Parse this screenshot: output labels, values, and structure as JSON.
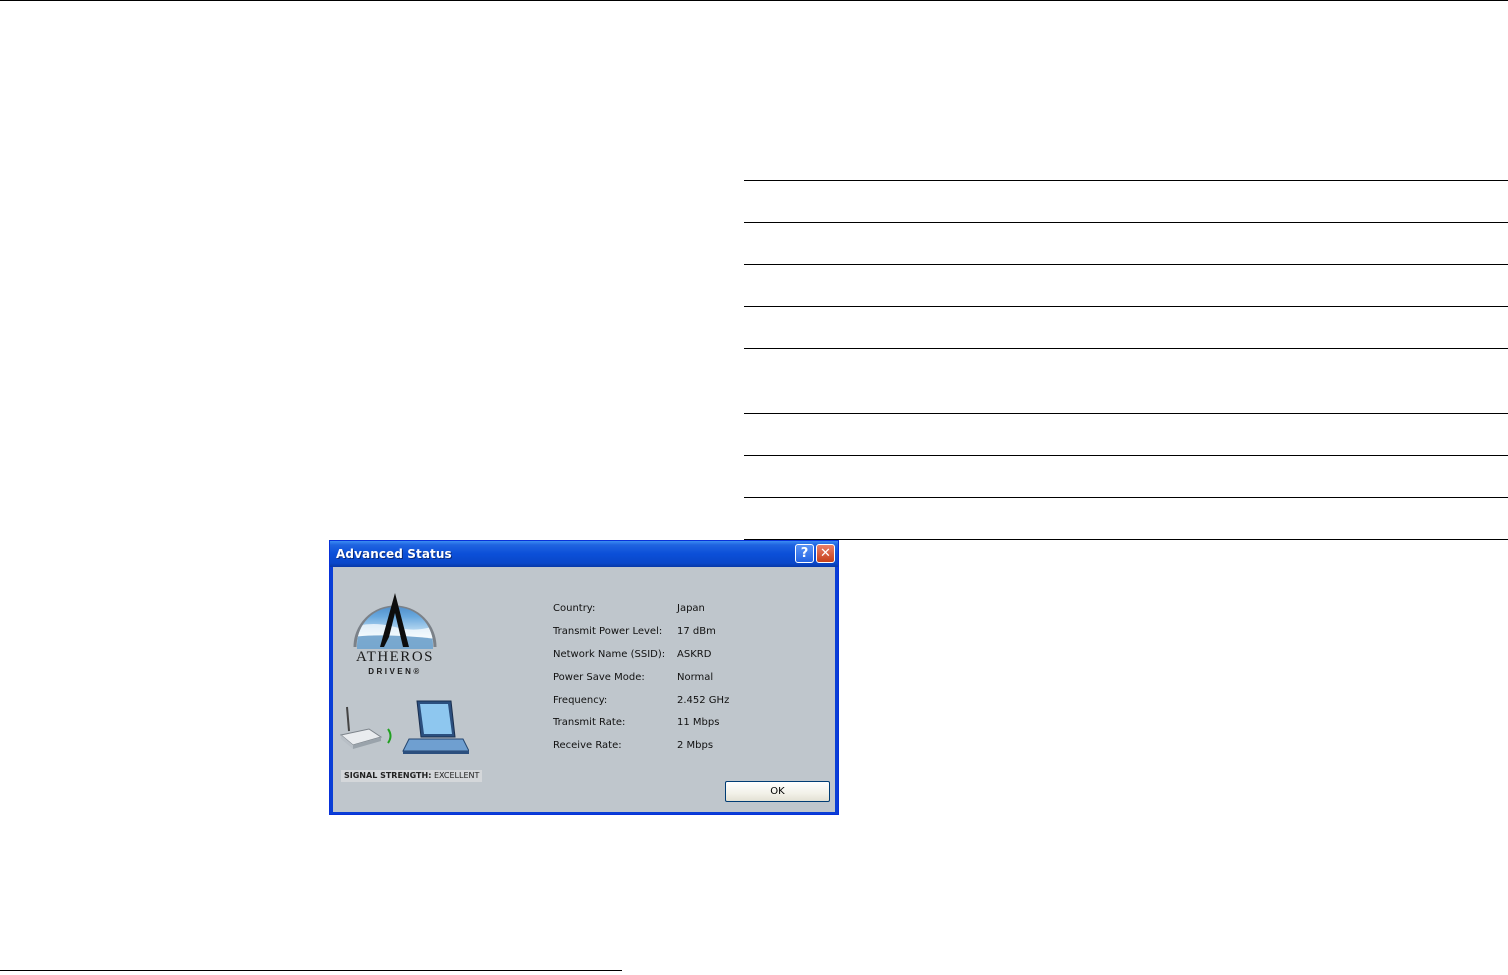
{
  "dialog": {
    "title": "Advanced Status",
    "help_glyph": "?",
    "close_glyph": "✕",
    "logo": {
      "wordmark": "ATHEROS",
      "subline": "DRIVEN®"
    },
    "signal": {
      "label": "SIGNAL STRENGTH:",
      "value": "EXCELLENT"
    },
    "info": [
      {
        "label": "Country:",
        "value": "Japan"
      },
      {
        "label": "Transmit Power Level:",
        "value": "17 dBm"
      },
      {
        "label": "Network Name (SSID):",
        "value": "ASKRD"
      },
      {
        "label": "Power Save Mode:",
        "value": "Normal"
      },
      {
        "label": "Frequency:",
        "value": "2.452 GHz"
      },
      {
        "label": "Transmit Rate:",
        "value": "11 Mbps"
      },
      {
        "label": "Receive Rate:",
        "value": "2 Mbps"
      }
    ],
    "ok_label": "OK",
    "icons": {
      "help": "help-icon",
      "close": "close-icon",
      "logo": "atheros-logo",
      "router": "router-icon",
      "signal": "signal-wave-icon",
      "laptop": "laptop-icon"
    },
    "colors": {
      "titlebar": "#0a47c9",
      "client_bg": "#bfc6cc",
      "close_button": "#c6401b"
    }
  }
}
